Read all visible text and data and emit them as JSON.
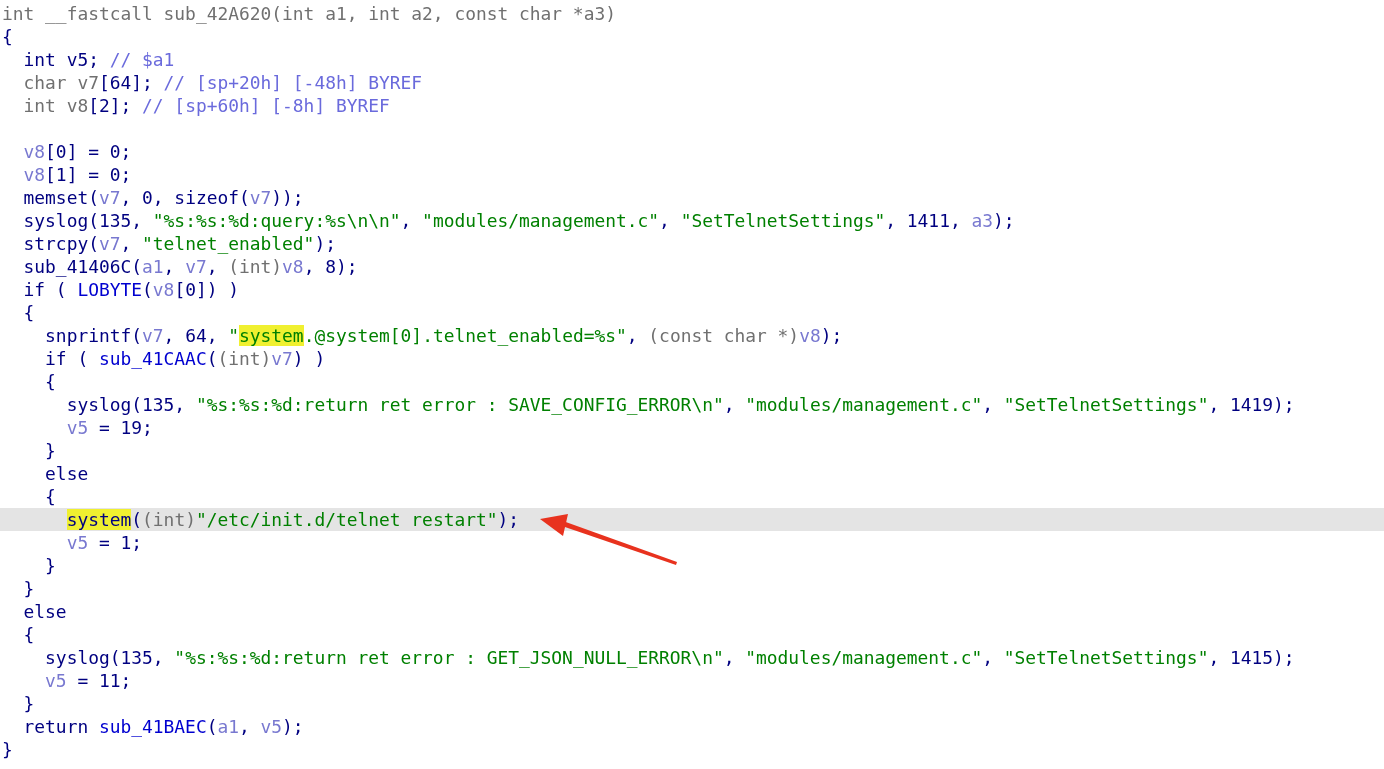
{
  "lines": [
    {
      "selected": false,
      "tokens": [
        {
          "text": "int __fastcall sub_42A620(int a1, int a2, const char *a3)",
          "kind": "type"
        }
      ]
    },
    {
      "selected": false,
      "tokens": [
        {
          "text": "{",
          "kind": "code"
        }
      ]
    },
    {
      "selected": false,
      "tokens": [
        {
          "text": "  int v5; ",
          "kind": "code"
        },
        {
          "text": "// $a1",
          "kind": "comment"
        }
      ]
    },
    {
      "selected": false,
      "tokens": [
        {
          "text": "  char v7",
          "kind": "type"
        },
        {
          "text": "[64]; ",
          "kind": "code"
        },
        {
          "text": "// [sp+20h] [-48h] BYREF",
          "kind": "comment"
        }
      ]
    },
    {
      "selected": false,
      "tokens": [
        {
          "text": "  int v8",
          "kind": "type"
        },
        {
          "text": "[2]; ",
          "kind": "code"
        },
        {
          "text": "// [sp+60h] [-8h] BYREF",
          "kind": "comment"
        }
      ]
    },
    {
      "selected": false
    },
    {
      "selected": false,
      "tokens": [
        {
          "text": "  v8",
          "kind": "var"
        },
        {
          "text": "[0] = 0;",
          "kind": "code"
        }
      ]
    },
    {
      "selected": false,
      "tokens": [
        {
          "text": "  v8",
          "kind": "var"
        },
        {
          "text": "[1] = 0;",
          "kind": "code"
        }
      ]
    },
    {
      "selected": false,
      "tokens": [
        {
          "text": "  memset(",
          "kind": "code"
        },
        {
          "text": "v7",
          "kind": "var"
        },
        {
          "text": ", 0, sizeof(",
          "kind": "code"
        },
        {
          "text": "v7",
          "kind": "var"
        },
        {
          "text": "));",
          "kind": "code"
        }
      ]
    },
    {
      "selected": false,
      "tokens": [
        {
          "text": "  syslog(135, ",
          "kind": "code"
        },
        {
          "text": "\"%s:%s:%d:query:%s\\n\\n\"",
          "kind": "string"
        },
        {
          "text": ", ",
          "kind": "code"
        },
        {
          "text": "\"modules/management.c\"",
          "kind": "string"
        },
        {
          "text": ", ",
          "kind": "code"
        },
        {
          "text": "\"SetTelnetSettings\"",
          "kind": "string"
        },
        {
          "text": ", 1411, ",
          "kind": "code"
        },
        {
          "text": "a3",
          "kind": "var"
        },
        {
          "text": ");",
          "kind": "code"
        }
      ]
    },
    {
      "selected": false,
      "tokens": [
        {
          "text": "  strcpy(",
          "kind": "code"
        },
        {
          "text": "v7",
          "kind": "var"
        },
        {
          "text": ", ",
          "kind": "code"
        },
        {
          "text": "\"telnet_enabled\"",
          "kind": "string"
        },
        {
          "text": ");",
          "kind": "code"
        }
      ]
    },
    {
      "selected": false,
      "tokens": [
        {
          "text": "  sub_41406C(",
          "kind": "code"
        },
        {
          "text": "a1",
          "kind": "var"
        },
        {
          "text": ", ",
          "kind": "code"
        },
        {
          "text": "v7",
          "kind": "var"
        },
        {
          "text": ", ",
          "kind": "code"
        },
        {
          "text": "(int)",
          "kind": "type"
        },
        {
          "text": "v8",
          "kind": "var"
        },
        {
          "text": ", 8);",
          "kind": "code"
        }
      ]
    },
    {
      "selected": false,
      "tokens": [
        {
          "text": "  if ( ",
          "kind": "code"
        },
        {
          "text": "LOBYTE",
          "kind": "call"
        },
        {
          "text": "(",
          "kind": "code"
        },
        {
          "text": "v8",
          "kind": "var"
        },
        {
          "text": "[0]) )",
          "kind": "code"
        }
      ]
    },
    {
      "selected": false,
      "tokens": [
        {
          "text": "  {",
          "kind": "code"
        }
      ]
    },
    {
      "selected": false,
      "tokens": [
        {
          "text": "    snprintf(",
          "kind": "code"
        },
        {
          "text": "v7",
          "kind": "var"
        },
        {
          "text": ", 64, ",
          "kind": "code"
        },
        {
          "text": "\"",
          "kind": "string"
        },
        {
          "text": "system",
          "kind": "string",
          "highlight": true
        },
        {
          "text": ".@system[0].telnet_enabled=%s\"",
          "kind": "string"
        },
        {
          "text": ", ",
          "kind": "code"
        },
        {
          "text": "(const char *)",
          "kind": "type"
        },
        {
          "text": "v8",
          "kind": "var"
        },
        {
          "text": ");",
          "kind": "code"
        }
      ]
    },
    {
      "selected": false,
      "tokens": [
        {
          "text": "    if ( ",
          "kind": "code"
        },
        {
          "text": "sub_41CAAC",
          "kind": "call"
        },
        {
          "text": "(",
          "kind": "code"
        },
        {
          "text": "(int)",
          "kind": "type"
        },
        {
          "text": "v7",
          "kind": "var"
        },
        {
          "text": ") )",
          "kind": "code"
        }
      ]
    },
    {
      "selected": false,
      "tokens": [
        {
          "text": "    {",
          "kind": "code"
        }
      ]
    },
    {
      "selected": false,
      "tokens": [
        {
          "text": "      syslog(135, ",
          "kind": "code"
        },
        {
          "text": "\"%s:%s:%d:return ret error : SAVE_CONFIG_ERROR\\n\"",
          "kind": "string"
        },
        {
          "text": ", ",
          "kind": "code"
        },
        {
          "text": "\"modules/management.c\"",
          "kind": "string"
        },
        {
          "text": ", ",
          "kind": "code"
        },
        {
          "text": "\"SetTelnetSettings\"",
          "kind": "string"
        },
        {
          "text": ", 1419);",
          "kind": "code"
        }
      ]
    },
    {
      "selected": false,
      "tokens": [
        {
          "text": "      v5",
          "kind": "var"
        },
        {
          "text": " = 19;",
          "kind": "code"
        }
      ]
    },
    {
      "selected": false,
      "tokens": [
        {
          "text": "    }",
          "kind": "code"
        }
      ]
    },
    {
      "selected": false,
      "tokens": [
        {
          "text": "    else",
          "kind": "code"
        }
      ]
    },
    {
      "selected": false,
      "tokens": [
        {
          "text": "    {",
          "kind": "code"
        }
      ]
    },
    {
      "selected": true,
      "tokens": [
        {
          "text": "      system",
          "kind": "code",
          "highlight": true
        },
        {
          "text": "(",
          "kind": "code"
        },
        {
          "text": "(int)",
          "kind": "type"
        },
        {
          "text": "\"/etc/init.d/telnet restart\"",
          "kind": "string"
        },
        {
          "text": ");",
          "kind": "code"
        }
      ]
    },
    {
      "selected": false,
      "tokens": [
        {
          "text": "      v5",
          "kind": "var"
        },
        {
          "text": " = 1;",
          "kind": "code"
        }
      ]
    },
    {
      "selected": false,
      "tokens": [
        {
          "text": "    }",
          "kind": "code"
        }
      ]
    },
    {
      "selected": false,
      "tokens": [
        {
          "text": "  }",
          "kind": "code"
        }
      ]
    },
    {
      "selected": false,
      "tokens": [
        {
          "text": "  else",
          "kind": "code"
        }
      ]
    },
    {
      "selected": false,
      "tokens": [
        {
          "text": "  {",
          "kind": "code"
        }
      ]
    },
    {
      "selected": false,
      "tokens": [
        {
          "text": "    syslog(135, ",
          "kind": "code"
        },
        {
          "text": "\"%s:%s:%d:return ret error : GET_JSON_NULL_ERROR\\n\"",
          "kind": "string"
        },
        {
          "text": ", ",
          "kind": "code"
        },
        {
          "text": "\"modules/management.c\"",
          "kind": "string"
        },
        {
          "text": ", ",
          "kind": "code"
        },
        {
          "text": "\"SetTelnetSettings\"",
          "kind": "string"
        },
        {
          "text": ", 1415);",
          "kind": "code"
        }
      ]
    },
    {
      "selected": false,
      "tokens": [
        {
          "text": "    v5",
          "kind": "var"
        },
        {
          "text": " = 11;",
          "kind": "code"
        }
      ]
    },
    {
      "selected": false,
      "tokens": [
        {
          "text": "  }",
          "kind": "code"
        }
      ]
    },
    {
      "selected": false,
      "tokens": [
        {
          "text": "  return ",
          "kind": "code"
        },
        {
          "text": "sub_41BAEC",
          "kind": "call"
        },
        {
          "text": "(",
          "kind": "code"
        },
        {
          "text": "a1",
          "kind": "var"
        },
        {
          "text": ", ",
          "kind": "code"
        },
        {
          "text": "v5",
          "kind": "var"
        },
        {
          "text": ");",
          "kind": "code"
        }
      ]
    },
    {
      "selected": false,
      "tokens": [
        {
          "text": "}",
          "kind": "code"
        }
      ]
    }
  ]
}
